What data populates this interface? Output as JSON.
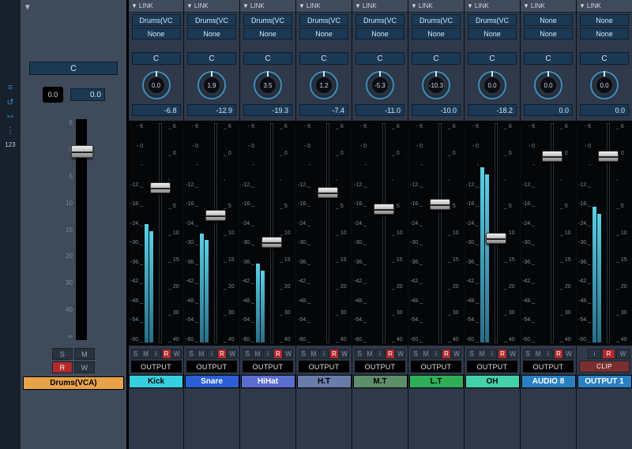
{
  "link_label": "LINK",
  "master": {
    "pan": "C",
    "knob_value": "0.0",
    "peak_value": "0.0",
    "buttons": {
      "S": "S",
      "M": "M",
      "R": "R",
      "W": "W"
    },
    "name": "Drums(VCA)",
    "name_color": "#e8a34a",
    "fader_pos_pct": 12,
    "scale": [
      "6",
      "0",
      "5",
      "10",
      "15",
      "20",
      "30",
      "40",
      "∞"
    ]
  },
  "channel_scale_left": [
    "- 6",
    "- 0",
    "-",
    "-12._",
    "-18._",
    "-24._",
    "-30._",
    "-36._",
    "-42._",
    "-48._",
    "-54._",
    "-60._"
  ],
  "channel_scale_right": [
    "_ 6",
    "_ 0",
    "-",
    "_ 5",
    "_ 10",
    "_ 15",
    "_ 20",
    "_ 30",
    "_ 40"
  ],
  "buttons_std": {
    "S": "S",
    "M": "M",
    "i": "i",
    "R": "R",
    "W": "W"
  },
  "tracks": [
    {
      "link1": "Drums(VC",
      "link2": "None",
      "pan": "C",
      "knob": "0.0",
      "gain": "-6.8",
      "output": "OUTPUT",
      "name": "Kick",
      "color": "#36cfe0",
      "fader_pct": 28,
      "meter_pct": 54,
      "show_smirw": true
    },
    {
      "link1": "Drums(VC",
      "link2": "None",
      "pan": "C",
      "knob": "1.9",
      "gain": "-12.9",
      "output": "OUTPUT",
      "name": "Snare",
      "color": "#2a5fd6",
      "fader_pct": 41,
      "meter_pct": 50,
      "show_smirw": true
    },
    {
      "link1": "Drums(VC",
      "link2": "None",
      "pan": "C",
      "knob": "3.5",
      "gain": "-19.3",
      "output": "OUTPUT",
      "name": "HiHat",
      "color": "#5a6ed0",
      "fader_pct": 54,
      "meter_pct": 36,
      "show_smirw": true
    },
    {
      "link1": "Drums(VC",
      "link2": "None",
      "pan": "C",
      "knob": "1.2",
      "gain": "-7.4",
      "output": "OUTPUT",
      "name": "H.T",
      "color": "#6a7da8",
      "fader_pct": 30,
      "meter_pct": 0,
      "show_smirw": true
    },
    {
      "link1": "Drums(VC",
      "link2": "None",
      "pan": "C",
      "knob": "-5.3",
      "gain": "-11.0",
      "output": "OUTPUT",
      "name": "M.T",
      "color": "#5e8e6a",
      "fader_pct": 38,
      "meter_pct": 0,
      "show_smirw": true
    },
    {
      "link1": "Drums(VC",
      "link2": "None",
      "pan": "C",
      "knob": "-10.3",
      "gain": "-10.0",
      "output": "OUTPUT",
      "name": "L.T",
      "color": "#2fae57",
      "fader_pct": 36,
      "meter_pct": 0,
      "show_smirw": true
    },
    {
      "link1": "Drums(VC",
      "link2": "None",
      "pan": "C",
      "knob": "0.0",
      "gain": "-18.2",
      "output": "OUTPUT",
      "name": "OH",
      "color": "#44d0a8",
      "fader_pct": 52,
      "meter_pct": 80,
      "show_smirw": true
    },
    {
      "link1": "None",
      "link2": "None",
      "pan": "C",
      "knob": "0.0",
      "gain": "0.0",
      "output": "OUTPUT",
      "name": "AUDIO 8",
      "color": "#2a80c2",
      "fader_pct": 13,
      "meter_pct": 0,
      "show_smirw": true
    },
    {
      "link1": "None",
      "link2": "None",
      "pan": "C",
      "knob": "0.0",
      "gain": "0.0",
      "output": "CLIP",
      "name": "OUTPUT 1",
      "color": "#2a80c2",
      "fader_pct": 13,
      "meter_pct": 62,
      "show_smirw": false,
      "clip": true
    }
  ],
  "tool_rail": {
    "bars": "≡",
    "undo": "↺",
    "span": "⇿",
    "menu": "⋮",
    "num": "123"
  }
}
